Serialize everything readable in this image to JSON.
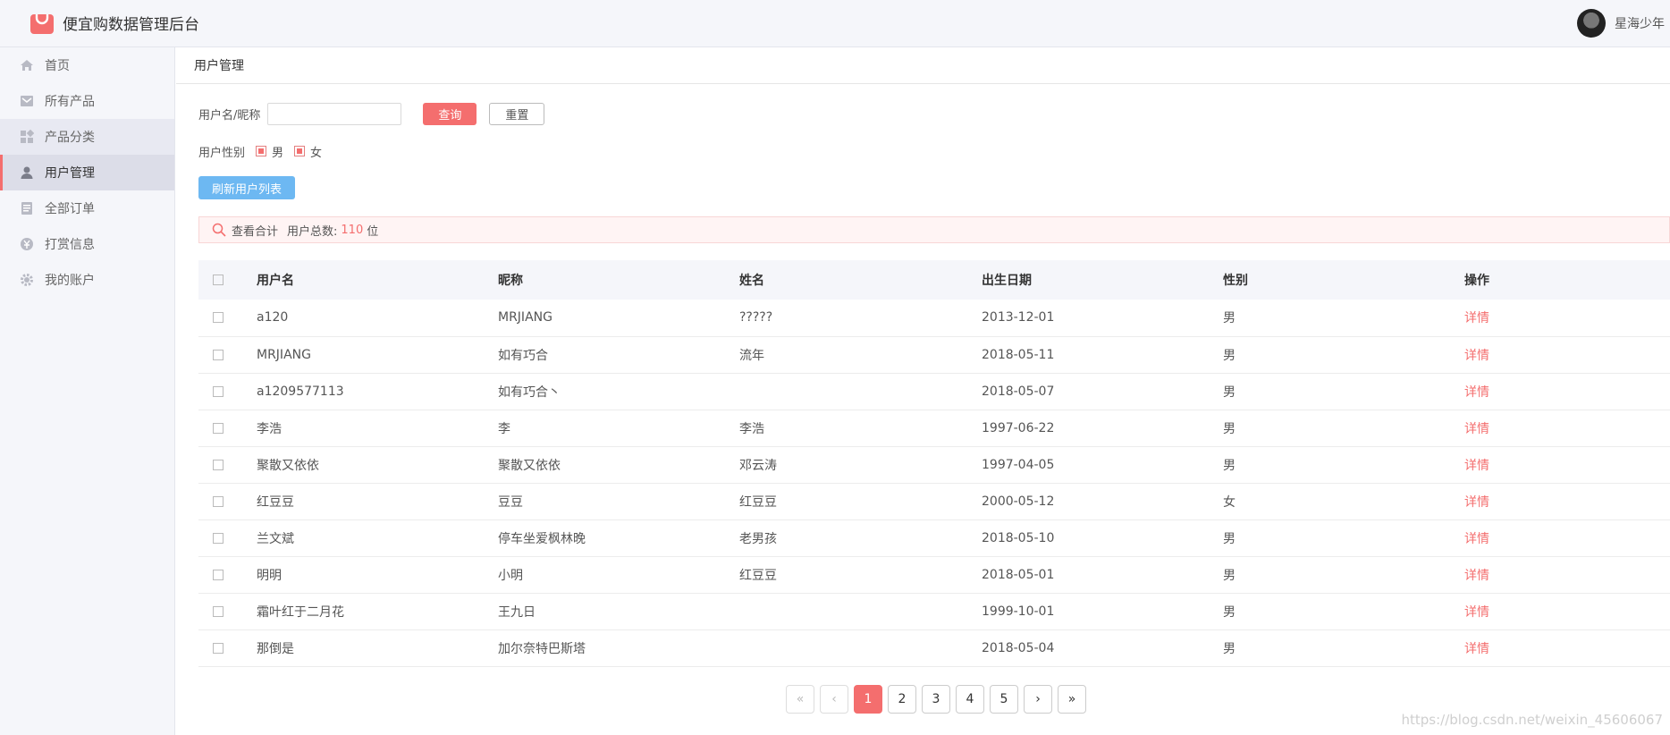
{
  "header": {
    "app_title": "便宜购数据管理后台",
    "username": "星海少年"
  },
  "sidebar": {
    "items": [
      {
        "label": "首页",
        "icon": "home-icon"
      },
      {
        "label": "所有产品",
        "icon": "products-icon"
      },
      {
        "label": "产品分类",
        "icon": "category-icon"
      },
      {
        "label": "用户管理",
        "icon": "user-icon"
      },
      {
        "label": "全部订单",
        "icon": "orders-icon"
      },
      {
        "label": "打赏信息",
        "icon": "reward-icon"
      },
      {
        "label": "我的账户",
        "icon": "gear-icon"
      }
    ]
  },
  "page": {
    "title": "用户管理"
  },
  "filters": {
    "name_label": "用户名/昵称",
    "name_value": "",
    "query_label": "查询",
    "reset_label": "重置",
    "gender_label": "用户性别",
    "gender_male": "男",
    "gender_female": "女",
    "refresh_label": "刷新用户列表"
  },
  "summary": {
    "prefix": "查看合计",
    "total_label": "用户总数:",
    "total": "110",
    "unit": "位"
  },
  "table": {
    "headers": [
      "用户名",
      "昵称",
      "姓名",
      "出生日期",
      "性别",
      "操作"
    ],
    "rows": [
      {
        "username": "a120",
        "nickname": "MRJIANG",
        "name": "?????",
        "birth": "2013-12-01",
        "gender": "男",
        "action": "详情"
      },
      {
        "username": "MRJIANG",
        "nickname": "如有巧合",
        "name": "流年",
        "birth": "2018-05-11",
        "gender": "男",
        "action": "详情"
      },
      {
        "username": "a1209577113",
        "nickname": "如有巧合丶",
        "name": "",
        "birth": "2018-05-07",
        "gender": "男",
        "action": "详情"
      },
      {
        "username": "李浩",
        "nickname": "李",
        "name": "李浩",
        "birth": "1997-06-22",
        "gender": "男",
        "action": "详情"
      },
      {
        "username": "聚散又依依",
        "nickname": "聚散又依依",
        "name": "邓云涛",
        "birth": "1997-04-05",
        "gender": "男",
        "action": "详情"
      },
      {
        "username": "红豆豆",
        "nickname": "豆豆",
        "name": "红豆豆",
        "birth": "2000-05-12",
        "gender": "女",
        "action": "详情"
      },
      {
        "username": "兰文斌",
        "nickname": "停车坐爱枫林晚",
        "name": "老男孩",
        "birth": "2018-05-10",
        "gender": "男",
        "action": "详情"
      },
      {
        "username": "明明",
        "nickname": "小明",
        "name": "红豆豆",
        "birth": "2018-05-01",
        "gender": "男",
        "action": "详情"
      },
      {
        "username": "霜叶红于二月花",
        "nickname": "王九日",
        "name": "",
        "birth": "1999-10-01",
        "gender": "男",
        "action": "详情"
      },
      {
        "username": "那倒是",
        "nickname": "加尔奈特巴斯塔",
        "name": "",
        "birth": "2018-05-04",
        "gender": "男",
        "action": "详情"
      }
    ]
  },
  "pagination": {
    "first": "«",
    "prev": "‹",
    "pages": [
      "1",
      "2",
      "3",
      "4",
      "5"
    ],
    "current": "1",
    "next": "›",
    "last": "»"
  },
  "watermark": "https://blog.csdn.net/weixin_45606067",
  "colors": {
    "accent": "#f46e6e",
    "refresh": "#6db8f2"
  }
}
